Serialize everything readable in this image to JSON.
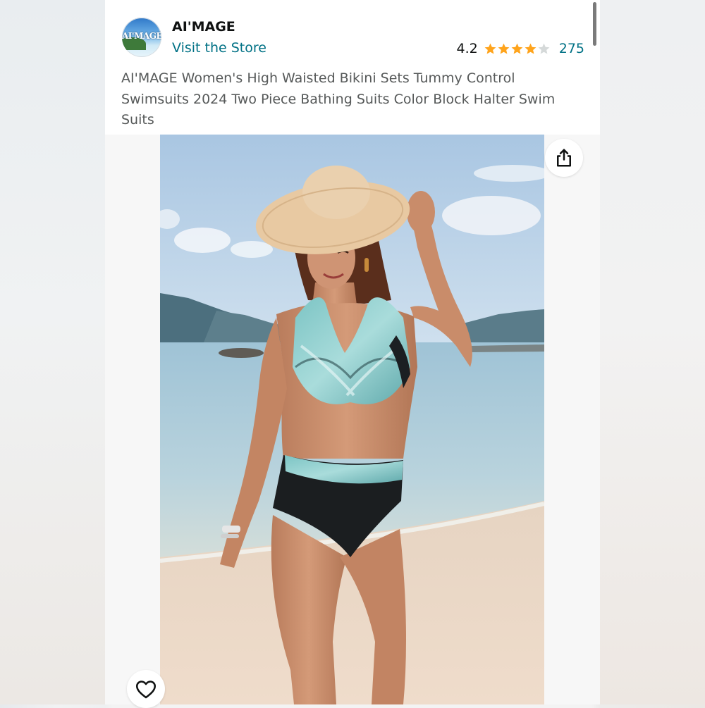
{
  "store": {
    "logo_text": "AI'MAGE",
    "brand_name": "AI'MAGE",
    "visit_link": "Visit the Store"
  },
  "rating": {
    "value": "4.2",
    "stars": 4.2,
    "review_count": "275",
    "star_color": "#ffa41c",
    "star_empty_color": "#d5d9d9"
  },
  "product": {
    "title": "AI'MAGE Women's High Waisted Bikini Sets Tummy Control Swimsuits 2024 Two Piece Bathing Suits Color Block Halter Swim Suits"
  },
  "gallery": {
    "image_alt": "Woman on a beach wearing a straw hat and a teal and black high waisted halter bikini",
    "share_icon": "share-icon",
    "wishlist_icon": "heart-icon"
  },
  "colors": {
    "link": "#007185",
    "text": "#0f1111",
    "secondary_text": "#565959"
  }
}
